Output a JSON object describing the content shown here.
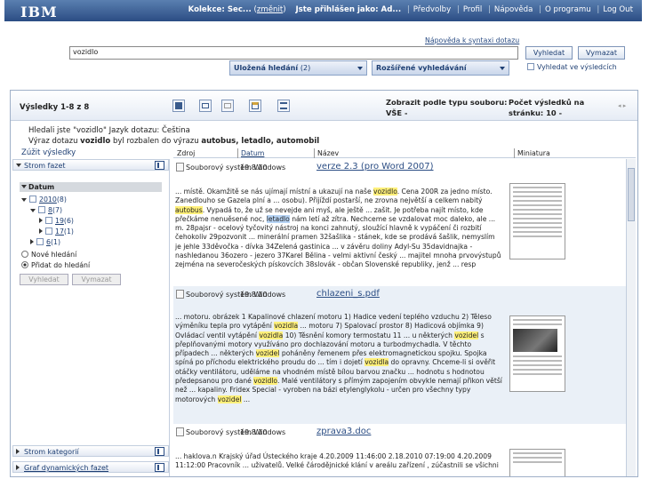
{
  "topbar": {
    "logo": "IBM",
    "collection_label": "Kolekce: Sec...",
    "change_link": "změnit",
    "logged_in": "Jste přihlášen jako: Ad...",
    "links": [
      "Předvolby",
      "Profil",
      "Nápověda",
      "O programu",
      "Log Out"
    ]
  },
  "search": {
    "syntax_help": "Nápověda k syntaxi dotazu",
    "query": "vozidlo",
    "search_button": "Vyhledat",
    "clear_button": "Vymazat",
    "saved_searches": "Uložená hledání",
    "saved_count": "(2)",
    "advanced_search": "Rozšířené vyhledávání",
    "search_in_results": "Vyhledat ve výsledcích"
  },
  "results": {
    "title": "Výsledky 1-8 z 8",
    "filetype_label": "Zobrazit podle typu souboru:",
    "filetype_value": "VŠE  -",
    "perpage_label": "Počet výsledků na",
    "perpage_label2": "stránku:",
    "perpage_value": "10  -",
    "info_line1": "Hledali jste \"vozidlo\"  Jazyk dotazu: Čeština",
    "info_line2_a": "Výraz dotazu ",
    "info_line2_b": "vozidlo",
    "info_line2_c": " byl rozbalen do výrazu ",
    "info_line2_d": "autobus, letadlo, automobil",
    "narrow": "Zúžit výsledky"
  },
  "facets": {
    "tree_facet": "Strom fazet",
    "datum": "Datum",
    "tree": [
      {
        "label": "2010",
        "count": "(8)"
      },
      {
        "label": "8",
        "count": "(7)"
      },
      {
        "label": "19",
        "count": "(6)"
      },
      {
        "label": "17",
        "count": "(1)"
      },
      {
        "label": "6",
        "count": "(1)"
      }
    ],
    "new_search": "Nové hledání",
    "add_search": "Přidat do hledání",
    "search_btn": "Vyhledat",
    "clear_btn": "Vymazat",
    "category_tree": "Strom kategorií",
    "dynamic_graph": "Graf dynamických fazet"
  },
  "table": {
    "headers": [
      "Zdroj",
      "Datum",
      "Název",
      "Miniatura"
    ],
    "rows": [
      {
        "source": "Souborový systém Windows",
        "date": "19.8.10",
        "title": "verze 2.3 (pro Word 2007)",
        "snippet_parts": [
          [
            "... místě. Okamžitě se nás ujímají místní a ukazují na naše ",
            ""
          ],
          [
            "vozidlo",
            "hl"
          ],
          [
            ". Cena 200R za jedno místo. Zanedlouho se Gazela plní a ... osobu). Přijíždí postarší, ne zrovna největší a celkem nabitý ",
            ""
          ],
          [
            "autobus",
            "hl"
          ],
          [
            ". Vypadá to, že už se nevejde ani myš, ale ještě ... zašit. Je potřeba najít místo, kde přečkáme nenuěsené noc, ",
            ""
          ],
          [
            "letadlo",
            "hl2"
          ],
          [
            " nám letí až zítra. Nechceme se vzdalovat moc daleko, ale ... m. 28pajsr - ocelový tyčovitý nástroj na konci zahnutý, sloužící hlavně k vypáčení či rozbití čehokoliv 29pozvonit ... minerální pramen 32šašlika - stánek, kde se prodává šašlik, nemyslím je jehle 33děvočka - dívka 34Zelená gastinica ... v závěru doliny Adyl-Su 35davidnajka - nashledanou 36ozero - jezero 37Karel Bělina - velmi aktivní český ... majitel mnoha prvovýstupů zejména na severočeských pískovcích 38slovák - občan Slovenské republiky, jenž ... resp",
            ""
          ]
        ]
      },
      {
        "source": "Souborový systém Windows",
        "date": "19.8.10",
        "title": "chlazeni_s.pdf",
        "snippet_parts": [
          [
            "... motoru. obrázek 1 Kapalinové chlazení motoru 1) Hadice vedení teplého vzduchu 2) Těleso výměníku tepla pro vytápění ",
            ""
          ],
          [
            "vozidla",
            "hl"
          ],
          [
            " ... motoru 7) Spalovací prostor 8) Hadicová objímka 9) Ovládací ventil vytápění ",
            ""
          ],
          [
            "vozidla",
            "hl"
          ],
          [
            " 10) Těsnění komory termostatu 11 ... u některých ",
            ""
          ],
          [
            "vozidel",
            "hl"
          ],
          [
            " s přeplňovanými motory využíváno pro dochlazování motoru a turbodmychadla. V těchto případech ... některých ",
            ""
          ],
          [
            "vozidel",
            "hl"
          ],
          [
            " poháněny řemenem přes elektromagnetickou spojku. Spojka spíná po příchodu elektrického proudu do ... tím i dojetí ",
            ""
          ],
          [
            "vozidla",
            "hl"
          ],
          [
            " do opravny. Chceme-li si ověřit otáčky ventilátoru, uděláme na vhodném místě bílou barvou značku ... hodnotu s hodnotou předepsanou pro dané ",
            ""
          ],
          [
            "vozidlo",
            "hl"
          ],
          [
            ". Malé ventilátory s přímým zapojením obvykle nemají přikon větší než ... kapaliny. Fridex Special - vyroben na bázi etylenglykolu - určen pro všechny typy motorových ",
            ""
          ],
          [
            "vozidel",
            "hl"
          ],
          [
            " ...",
            ""
          ]
        ]
      },
      {
        "source": "Souborový systém Windows",
        "date": "19.8.10",
        "title": "zprava3.doc",
        "snippet_parts": [
          [
            "... haklova.n Krajský úřad Ústeckého kraje 4.20.2009 11:46:00 2.18.2010 07:19:00 4.20.2009 11:12:00 Pracovník ... uživatelů. Velké čárodějnické klání v areálu zařízení , zúčastnili se všichni",
            ""
          ]
        ]
      }
    ]
  }
}
